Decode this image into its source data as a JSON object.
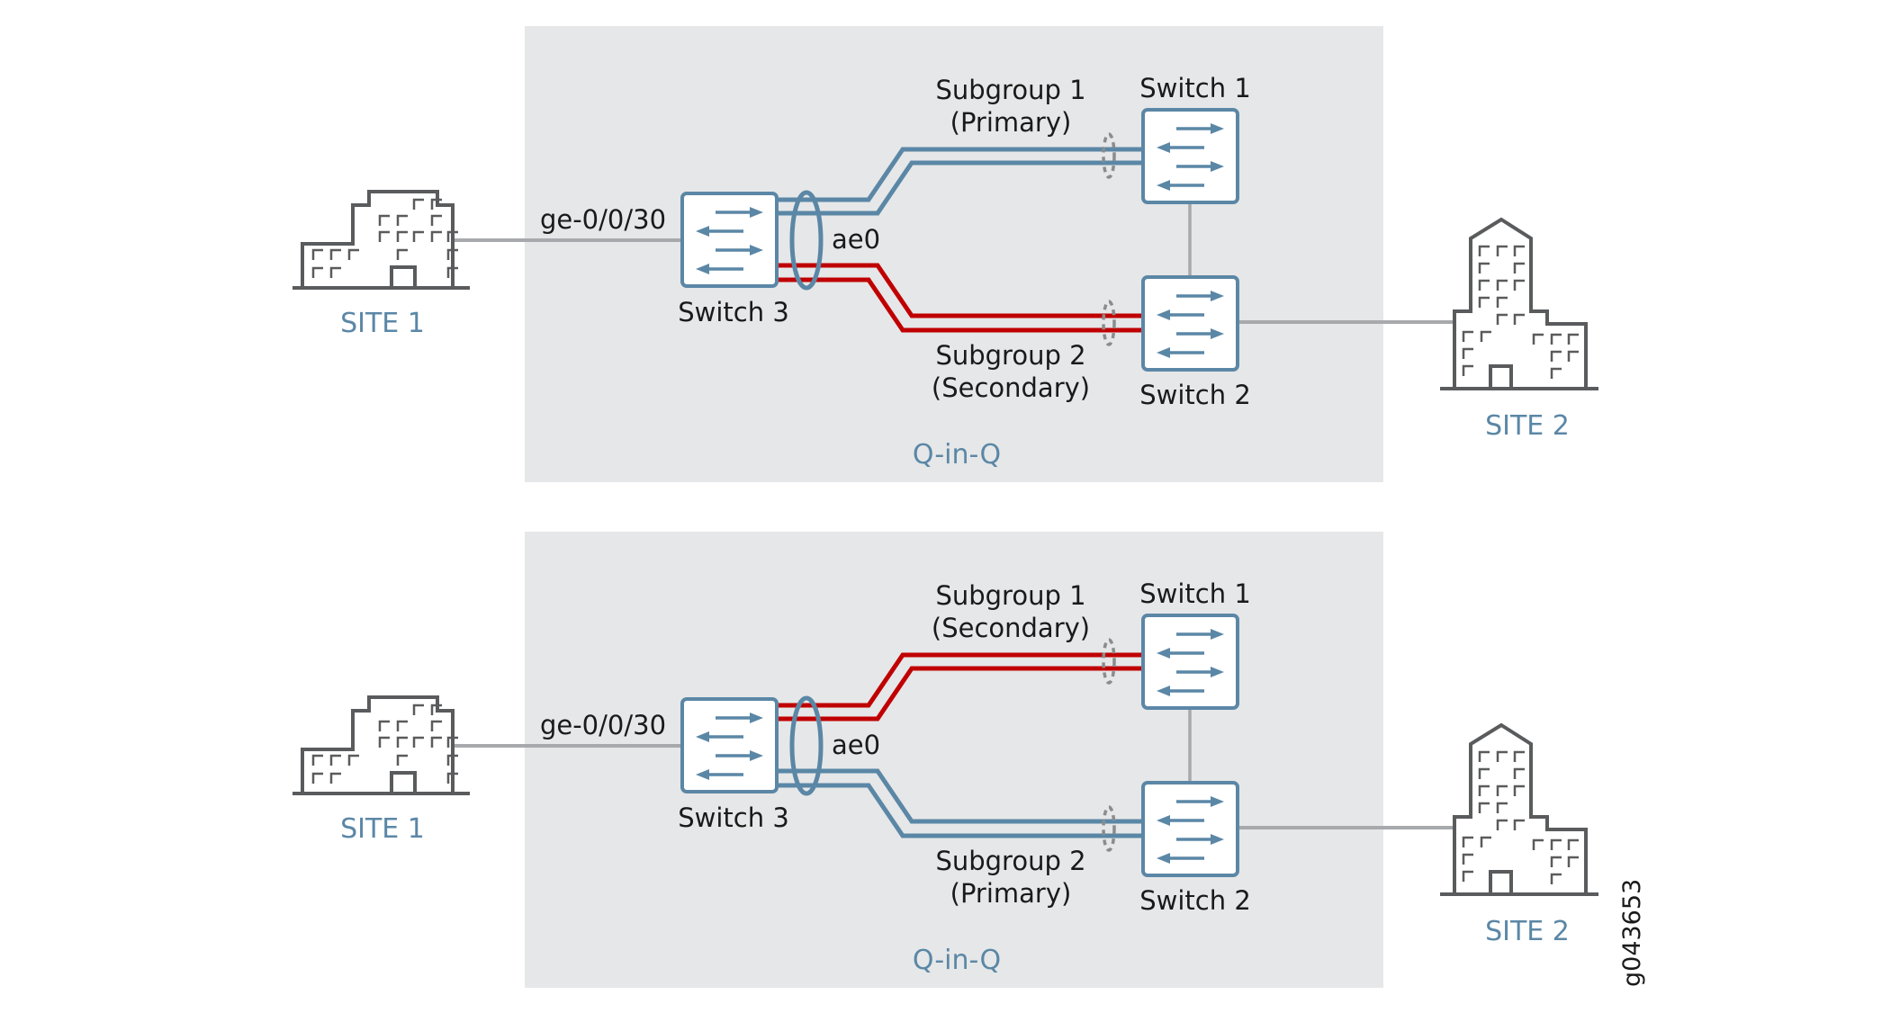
{
  "colors": {
    "panel_bg": "#e6e7e8",
    "blue": "#5b87a6",
    "red": "#c00000",
    "gray_link": "#a7a9ac",
    "building": "#5a5b5d",
    "dashed_ellipse": "#8a8c8e",
    "text": "#1a1a1a"
  },
  "figure_id": "g043653",
  "panels": [
    {
      "site1_label": "SITE 1",
      "site2_label": "SITE 2",
      "interface_label": "ge-0/0/30",
      "lag_label": "ae0",
      "switch1_label": "Switch 1",
      "switch2_label": "Switch 2",
      "switch3_label": "Switch 3",
      "subgroup1": {
        "name": "Subgroup 1",
        "role": "(Primary)",
        "link_color": "blue"
      },
      "subgroup2": {
        "name": "Subgroup 2",
        "role": "(Secondary)",
        "link_color": "red"
      },
      "zone_label": "Q-in-Q"
    },
    {
      "site1_label": "SITE 1",
      "site2_label": "SITE 2",
      "interface_label": "ge-0/0/30",
      "lag_label": "ae0",
      "switch1_label": "Switch 1",
      "switch2_label": "Switch 2",
      "switch3_label": "Switch 3",
      "subgroup1": {
        "name": "Subgroup 1",
        "role": "(Secondary)",
        "link_color": "red"
      },
      "subgroup2": {
        "name": "Subgroup 2",
        "role": "(Primary)",
        "link_color": "blue"
      },
      "zone_label": "Q-in-Q"
    }
  ]
}
